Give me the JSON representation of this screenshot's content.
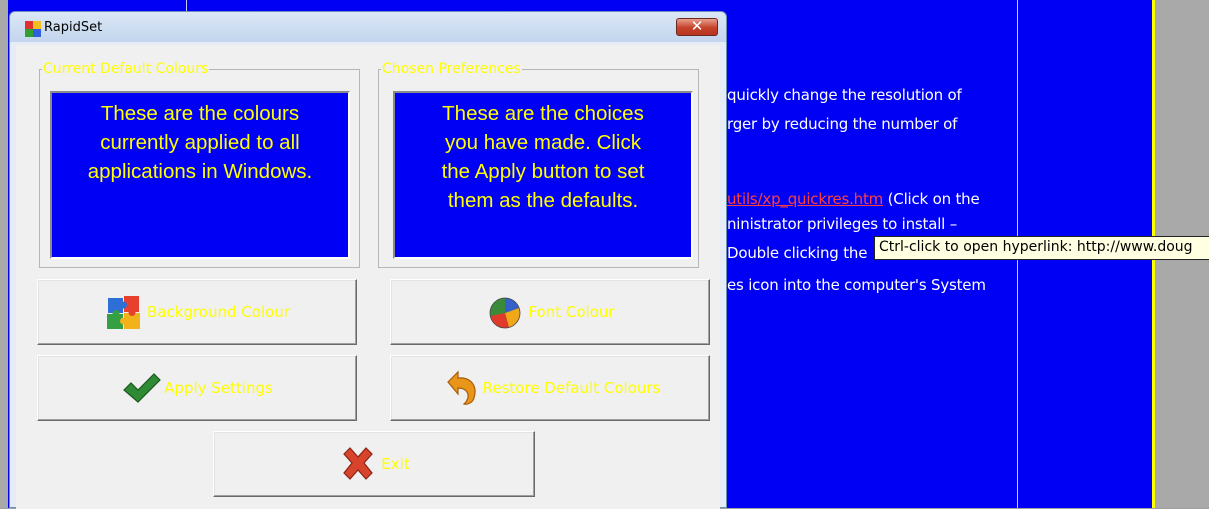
{
  "window": {
    "title": "RapidSet",
    "close_glyph": "✕"
  },
  "current_colours": {
    "legend": "Current Default Colours",
    "lines": [
      "These are the colours",
      "currently applied to all",
      "applications in Windows."
    ]
  },
  "chosen_preferences": {
    "legend": "Chosen Preferences",
    "lines": [
      "These are the choices",
      "you have made.  Click",
      "the Apply button to set",
      "them as the defaults."
    ]
  },
  "buttons": {
    "background_colour": {
      "label": "Background Colour",
      "icon": "puzzle-icon"
    },
    "font_colour": {
      "label": "Font Colour",
      "icon": "pie-chart-icon"
    },
    "apply_settings": {
      "label": "Apply Settings",
      "icon": "checkmark-icon"
    },
    "restore_defaults": {
      "label": "Restore Default Colours",
      "icon": "undo-arrow-icon"
    },
    "exit": {
      "label": "Exit",
      "icon": "red-x-icon"
    }
  },
  "document": {
    "line1": "quickly change the resolution of",
    "line2": "rger by reducing the number of",
    "link": "utils/xp_quickres.htm",
    "line3_rest": " (Click on the",
    "line4": "ninistrator privileges to install –",
    "line5": "Double clicking the",
    "line6": "es icon into the computer's System"
  },
  "tooltip": {
    "text": "Ctrl-click to open hyperlink: http://www.doug"
  },
  "colors": {
    "panel_bg": "#0000f4",
    "label_yellow": "#ffff00",
    "doc_bg": "#0000f4"
  }
}
